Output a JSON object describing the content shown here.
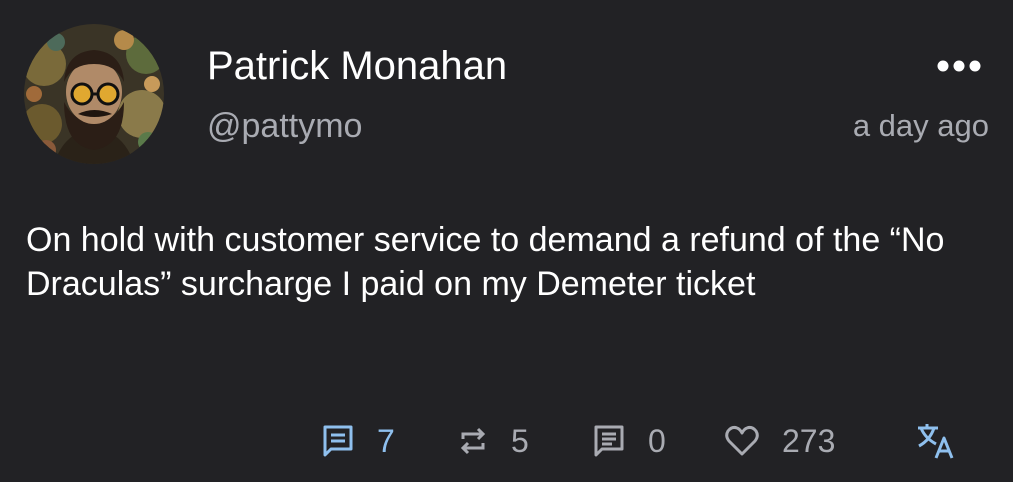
{
  "post": {
    "display_name": "Patrick Monahan",
    "handle": "@pattymo",
    "time": "a day ago",
    "text": "On hold with customer service to demand a refund of the “No Draculas” surcharge I paid on my Demeter ticket",
    "more_icon": "more-horizontal-icon"
  },
  "actions": {
    "replies": "7",
    "boosts": "5",
    "quotes": "0",
    "favourites": "273",
    "translate_icon": "translate-icon"
  },
  "colors": {
    "background": "#222225",
    "text": "#ffffff",
    "muted": "#a9abb2",
    "accent": "#8fc0ee"
  }
}
